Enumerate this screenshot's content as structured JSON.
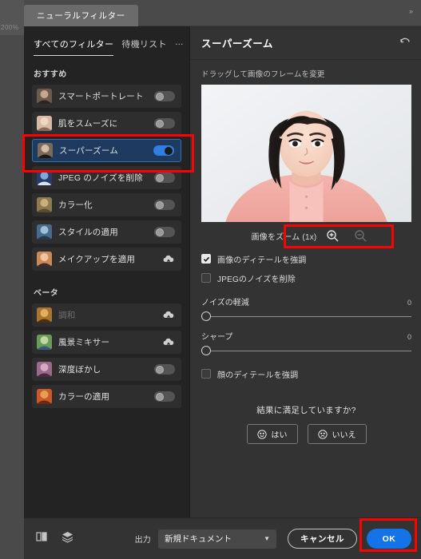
{
  "window": {
    "tab_label": "ニューラルフィルター",
    "doc_zoom": "200%",
    "collapse_icon": "double-chevron-right-icon"
  },
  "left_panel": {
    "tabs": [
      {
        "label": "すべてのフィルター",
        "active": true
      },
      {
        "label": "待機リスト",
        "active": false
      }
    ],
    "overflow_label": "…",
    "sections": [
      {
        "title": "おすすめ",
        "items": [
          {
            "label": "スマートポートレート",
            "control": "toggle",
            "state": "off",
            "thumb": "portrait-man-thumb"
          },
          {
            "label": "肌をスムーズに",
            "control": "toggle",
            "state": "off",
            "thumb": "skin-face-thumb"
          },
          {
            "label": "スーパーズーム",
            "control": "toggle",
            "state": "on",
            "selected": true,
            "thumb": "super-zoom-thumb"
          },
          {
            "label": "JPEG のノイズを削除",
            "control": "toggle",
            "state": "off",
            "thumb": "jpeg-artifacts-thumb"
          },
          {
            "label": "カラー化",
            "control": "toggle",
            "state": "off",
            "thumb": "colorize-thumb"
          },
          {
            "label": "スタイルの適用",
            "control": "toggle",
            "state": "off",
            "thumb": "style-transfer-thumb"
          },
          {
            "label": "メイクアップを適用",
            "control": "cloud",
            "state": "download",
            "thumb": "makeup-thumb"
          }
        ]
      },
      {
        "title": "ベータ",
        "items": [
          {
            "label": "調和",
            "control": "cloud",
            "state": "download",
            "disabled": true,
            "thumb": "harmonization-thumb"
          },
          {
            "label": "風景ミキサー",
            "control": "cloud",
            "state": "download",
            "thumb": "landscape-mixer-thumb"
          },
          {
            "label": "深度ぼかし",
            "control": "toggle",
            "state": "off",
            "thumb": "depth-blur-thumb"
          },
          {
            "label": "カラーの適用",
            "control": "toggle",
            "state": "off",
            "thumb": "color-transfer-thumb"
          }
        ]
      }
    ]
  },
  "right_panel": {
    "title": "スーパーズーム",
    "reset_icon": "undo-reset-icon",
    "drag_hint": "ドラッグして画像のフレームを変更",
    "preview_alt": "portrait-photo-preview",
    "zoom": {
      "label": "画像をズーム (1x)",
      "zoom_in_icon": "magnifier-plus-icon",
      "zoom_out_icon": "magnifier-minus-icon",
      "zoom_out_disabled": true
    },
    "checkboxes": [
      {
        "label": "画像のディテールを強調",
        "checked": true
      },
      {
        "label": "JPEGのノイズを削除",
        "checked": false
      }
    ],
    "sliders": [
      {
        "label": "ノイズの軽減",
        "value": "0",
        "percent": 0
      },
      {
        "label": "シャープ",
        "value": "0",
        "percent": 0
      }
    ],
    "face_checkbox": {
      "label": "顔のディテールを強調",
      "checked": false
    },
    "feedback": {
      "question": "結果に満足していますか?",
      "yes_label": "はい",
      "no_label": "いいえ",
      "yes_icon": "smiley-happy-icon",
      "no_icon": "smiley-sad-icon"
    }
  },
  "bottom_bar": {
    "compare_icon": "before-after-compare-icon",
    "layers_icon": "layers-stack-icon",
    "output_label": "出力",
    "output_value": "新規ドキュメント",
    "caret_icon": "chevron-down-icon",
    "cancel_label": "キャンセル",
    "ok_label": "OK"
  },
  "colors": {
    "accent_blue": "#1473e6",
    "toggle_on": "#2f7fe0",
    "annotation_red": "#ff0000",
    "panel_bg": "#333333",
    "list_bg": "#232323"
  }
}
